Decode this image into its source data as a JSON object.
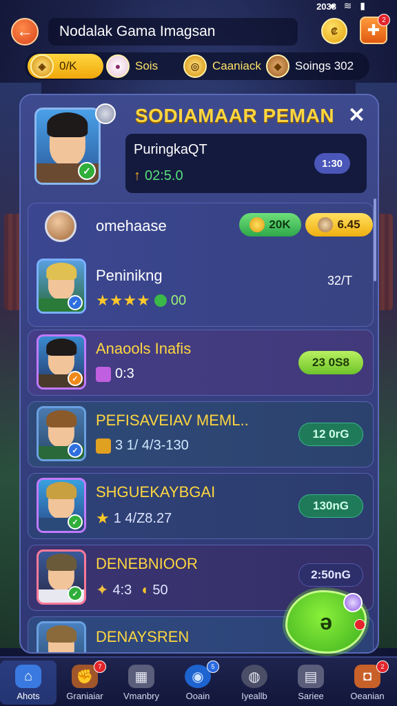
{
  "status": {
    "time": "2038",
    "icons": "● ≋ ▮"
  },
  "header": {
    "back_glyph": "←",
    "title": "Nodalak Gama Imagsan",
    "coin_glyph": "₡",
    "gift_glyph": "✚",
    "gift_badge": "2"
  },
  "currency": [
    {
      "label": "0/K",
      "icon": "coin-icon",
      "glyph": "◈"
    },
    {
      "label": "Sois",
      "icon": "mascot-icon",
      "glyph": "●"
    },
    {
      "label": "Caaniack",
      "icon": "gold-coin-icon",
      "glyph": "◎"
    },
    {
      "label": "Soings 302",
      "icon": "bronze-coin-icon",
      "glyph": "◆"
    }
  ],
  "panel": {
    "title": "SODIAMAAR PEMAN",
    "close_glyph": "✕",
    "profile_name": "PuringkaQT",
    "profile_stat": "02:5.0",
    "profile_pill": "1:30"
  },
  "list_header": {
    "label": "omehaase",
    "pill_green": "20K",
    "pill_yellow": "6.45"
  },
  "players": [
    {
      "name": "Peninikng",
      "sub_value": "00",
      "stars": "★★★★",
      "right_value": "32/T",
      "badge": "blue",
      "name_color": "#ffffff"
    },
    {
      "name": "Anaools Inafis",
      "sub_value": "0:3",
      "right_value": "23 0S8",
      "badge": "orange",
      "name_color": "#ffd640"
    },
    {
      "name": "PEFISAVEIAV MEML..",
      "sub_value": "3 1/ 4/3-130",
      "right_value": "12 0rG",
      "badge": "blue",
      "name_color": "#ffd640"
    },
    {
      "name": "SHGUEKAYBGAI",
      "sub_value": "1 4/Z8.27",
      "right_value": "130nG",
      "badge": "green",
      "name_color": "#ffd640"
    },
    {
      "name": "DENEBNIOOR",
      "sub_value": "4:3",
      "sub_value_2": "50",
      "right_value": "2:50nG",
      "badge": "green",
      "name_color": "#ffd640"
    },
    {
      "name": "DENAYSREN",
      "badge": "blue",
      "name_color": "#ffd640"
    }
  ],
  "burst": {
    "label": "ǝ"
  },
  "bottom_nav": [
    {
      "label": "Ahots",
      "icon": "home-icon",
      "glyph": "⌂",
      "active": true
    },
    {
      "label": "Graniaiar",
      "icon": "gloves-icon",
      "glyph": "✊",
      "badge": "7"
    },
    {
      "label": "Vmanbry",
      "icon": "grid-icon",
      "glyph": "▦"
    },
    {
      "label": "Ooain",
      "icon": "orb-icon",
      "glyph": "◉",
      "badge": "5"
    },
    {
      "label": "Iyeallb",
      "icon": "ball-icon",
      "glyph": "◍"
    },
    {
      "label": "Sariee",
      "icon": "card-icon",
      "glyph": "▤"
    },
    {
      "label": "Oeanian",
      "icon": "chest-icon",
      "glyph": "◘",
      "badge": "2"
    }
  ]
}
